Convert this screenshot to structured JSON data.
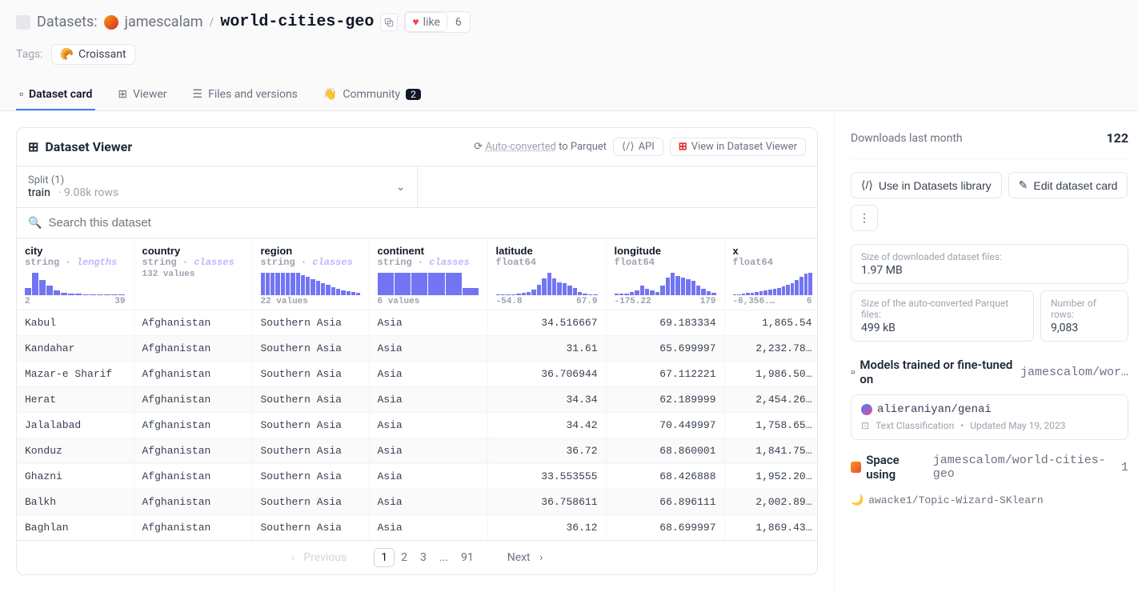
{
  "header": {
    "datasets_label": "Datasets:",
    "owner": "jamescalam",
    "name": "world-cities-geo",
    "like_label": "like",
    "like_count": "6",
    "tags_label": "Tags:",
    "croissant": "Croissant"
  },
  "tabs": {
    "card": "Dataset card",
    "viewer": "Viewer",
    "files": "Files and versions",
    "community": "Community",
    "community_count": "2"
  },
  "viewer": {
    "title": "Dataset Viewer",
    "auto": "Auto-converted",
    "auto_to": " to Parquet",
    "api": "API",
    "open": "View in Dataset Viewer",
    "split_label": "Split (1)",
    "split_value": "train",
    "rows": "9.08k rows",
    "search_placeholder": "Search this dataset"
  },
  "columns": [
    {
      "name": "city",
      "type": "string",
      "sub": "lengths",
      "labelL": "2",
      "labelR": "39",
      "hist": [
        30,
        90,
        60,
        40,
        20,
        10,
        8,
        6,
        4,
        3,
        3,
        2,
        2,
        2
      ]
    },
    {
      "name": "country",
      "type": "string",
      "sub": "classes",
      "labelL": "132 values",
      "labelR": "",
      "hist": []
    },
    {
      "name": "region",
      "type": "string",
      "sub": "classes",
      "labelL": "22 values",
      "labelR": "",
      "hist": [
        55,
        55,
        55,
        55,
        55,
        55,
        55,
        55,
        50,
        45,
        40,
        35,
        30,
        25,
        20,
        15,
        12,
        10,
        8,
        5
      ]
    },
    {
      "name": "continent",
      "type": "string",
      "sub": "classes",
      "labelL": "6 values",
      "labelR": "",
      "hist": [
        60,
        60,
        60,
        60,
        60,
        20
      ]
    },
    {
      "name": "latitude",
      "type": "float64",
      "sub": "",
      "labelL": "-54.8",
      "labelR": "67.9",
      "hist": [
        5,
        5,
        5,
        5,
        8,
        10,
        15,
        25,
        45,
        70,
        95,
        70,
        55,
        50,
        40,
        30,
        15,
        8,
        5,
        5
      ]
    },
    {
      "name": "longitude",
      "type": "float64",
      "sub": "",
      "labelL": "-175.22",
      "labelR": "179",
      "hist": [
        5,
        5,
        5,
        10,
        15,
        30,
        20,
        15,
        10,
        30,
        55,
        70,
        60,
        55,
        50,
        45,
        30,
        20,
        12,
        8
      ]
    },
    {
      "name": "x",
      "type": "float64",
      "sub": "",
      "labelL": "-6,356.…",
      "labelR": "6",
      "hist": [
        5,
        5,
        8,
        10,
        12,
        15,
        18,
        22,
        25,
        28,
        32,
        38,
        45,
        55,
        68,
        82,
        95,
        100
      ]
    }
  ],
  "rows": [
    {
      "city": "Kabul",
      "country": "Afghanistan",
      "region": "Southern Asia",
      "continent": "Asia",
      "lat": "34.516667",
      "lon": "69.183334",
      "x": "1,865.54"
    },
    {
      "city": "Kandahar",
      "country": "Afghanistan",
      "region": "Southern Asia",
      "continent": "Asia",
      "lat": "31.61",
      "lon": "65.699997",
      "x": "2,232.78…"
    },
    {
      "city": "Mazar-e Sharif",
      "country": "Afghanistan",
      "region": "Southern Asia",
      "continent": "Asia",
      "lat": "36.706944",
      "lon": "67.112221",
      "x": "1,986.50…"
    },
    {
      "city": "Herat",
      "country": "Afghanistan",
      "region": "Southern Asia",
      "continent": "Asia",
      "lat": "34.34",
      "lon": "62.189999",
      "x": "2,454.26…"
    },
    {
      "city": "Jalalabad",
      "country": "Afghanistan",
      "region": "Southern Asia",
      "continent": "Asia",
      "lat": "34.42",
      "lon": "70.449997",
      "x": "1,758.65…"
    },
    {
      "city": "Konduz",
      "country": "Afghanistan",
      "region": "Southern Asia",
      "continent": "Asia",
      "lat": "36.72",
      "lon": "68.860001",
      "x": "1,841.75…"
    },
    {
      "city": "Ghazni",
      "country": "Afghanistan",
      "region": "Southern Asia",
      "continent": "Asia",
      "lat": "33.553555",
      "lon": "68.426888",
      "x": "1,952.20…"
    },
    {
      "city": "Balkh",
      "country": "Afghanistan",
      "region": "Southern Asia",
      "continent": "Asia",
      "lat": "36.758611",
      "lon": "66.896111",
      "x": "2,002.89…"
    },
    {
      "city": "Baghlan",
      "country": "Afghanistan",
      "region": "Southern Asia",
      "continent": "Asia",
      "lat": "36.12",
      "lon": "68.699997",
      "x": "1,869.43…"
    }
  ],
  "pager": {
    "prev": "Previous",
    "next": "Next",
    "pages": [
      "1",
      "2",
      "3",
      "...",
      "91"
    ]
  },
  "side": {
    "downloads_label": "Downloads last month",
    "downloads": "122",
    "use_lib": "Use in Datasets library",
    "edit_card": "Edit dataset card",
    "s1_lbl": "Size of downloaded dataset files:",
    "s1_val": "1.97 MB",
    "s2_lbl": "Size of the auto-converted Parquet files:",
    "s2_val": "499 kB",
    "s3_lbl": "Number of rows:",
    "s3_val": "9,083",
    "models_h": "Models trained or fine-tuned on",
    "models_ref": "jamescalom/wor…",
    "model_name": "alieraniyan/genai",
    "model_task": "Text Classification",
    "model_updated": "Updated May 19, 2023",
    "space_h": "Space using",
    "space_ref": "jamescalom/world-cities-geo",
    "space_count": "1",
    "space_item": "awacke1/Topic-Wizard-SKlearn"
  }
}
